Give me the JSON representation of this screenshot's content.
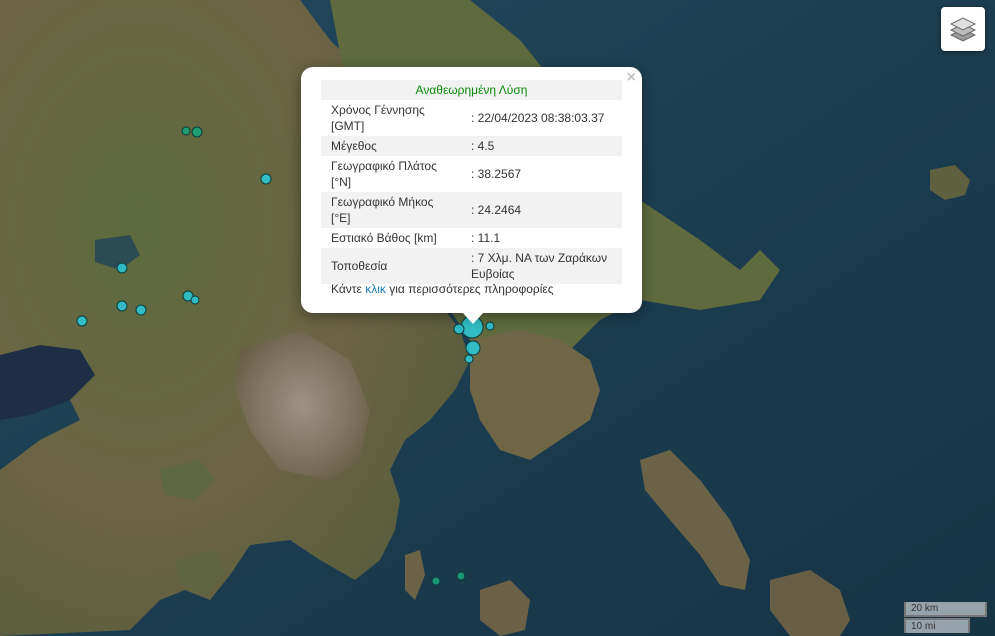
{
  "popup": {
    "header": "Αναθεωρημένη Λύση",
    "rows": [
      {
        "label": "Χρόνος Γέννησης [GMT]",
        "value": ": 22/04/2023 08:38:03.37"
      },
      {
        "label": "Μέγεθος",
        "value": ": 4.5"
      },
      {
        "label": "Γεωγραφικό Πλάτος [°N]",
        "value": ": 38.2567"
      },
      {
        "label": "Γεωγραφικό Μήκος [°E]",
        "value": ": 24.2464"
      },
      {
        "label": "Εστιακό Βάθος [km]",
        "value": ": 11.1"
      },
      {
        "label": "Τοποθεσία",
        "value": ": 7 Χλμ. ΝΑ των Ζαράκων Ευβοίας"
      }
    ],
    "more_prefix": "Κάντε",
    "more_link": "κλικ",
    "more_suffix": "για περισσότερες πληροφορίες",
    "close_glyph": "×"
  },
  "scale": {
    "km": "20 km",
    "mi": "10 mi"
  },
  "icons": {
    "layers": "layers-icon",
    "close": "close-icon"
  },
  "colors": {
    "recent_marker": "#2cc5d2",
    "older_marker": "#1aa37a",
    "popup_header": "#0a8a0a",
    "link": "#1a7ab5"
  }
}
